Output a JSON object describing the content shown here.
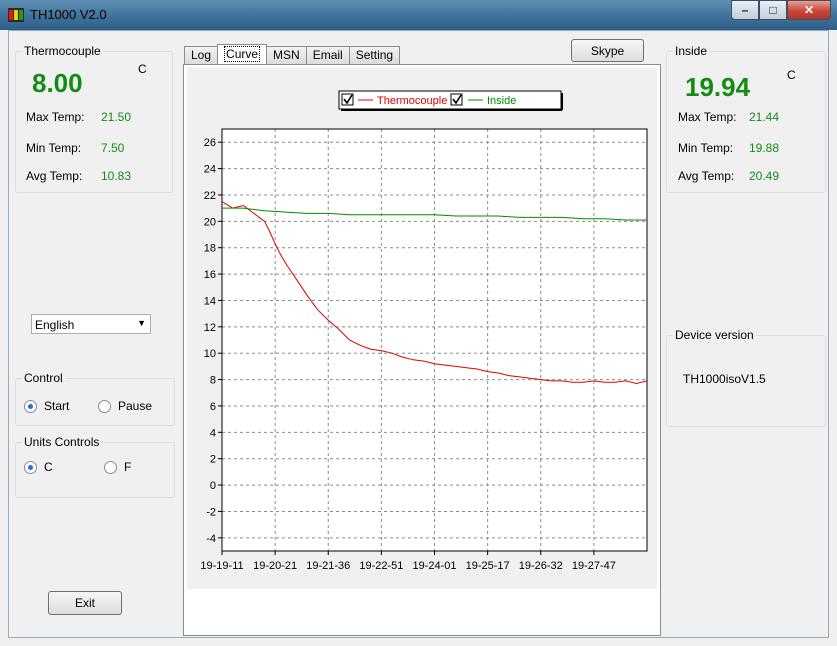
{
  "window": {
    "title": "TH1000 V2.0"
  },
  "thermocouple": {
    "group_label": "Thermocouple",
    "value": "8.00",
    "unit": "C",
    "max_label": "Max Temp:",
    "max_value": "21.50",
    "min_label": "Min Temp:",
    "min_value": "7.50",
    "avg_label": "Avg Temp:",
    "avg_value": "10.83"
  },
  "inside": {
    "group_label": "Inside",
    "value": "19.94",
    "unit": "C",
    "max_label": "Max Temp:",
    "max_value": "21.44",
    "min_label": "Min Temp:",
    "min_value": "19.88",
    "avg_label": "Avg Temp:",
    "avg_value": "20.49"
  },
  "language": {
    "selected": "English"
  },
  "control": {
    "group_label": "Control",
    "start_label": "Start",
    "pause_label": "Pause",
    "selected": "Start"
  },
  "units": {
    "group_label": "Units Controls",
    "c_label": "C",
    "f_label": "F",
    "selected": "C"
  },
  "exit_label": "Exit",
  "skype_label": "Skype",
  "tabs": [
    "Log",
    "Curve",
    "MSN",
    "Email",
    "Setting"
  ],
  "active_tab": "Curve",
  "device": {
    "group_label": "Device version",
    "version": "TH1000isoV1.5"
  },
  "colors": {
    "value_green": "#148c14",
    "thermocouple_series": "#e00000",
    "inside_series": "#008c00"
  },
  "chart_data": {
    "type": "line",
    "legend": [
      "Thermocouple",
      "Inside"
    ],
    "legend_checked": [
      true,
      true
    ],
    "grid": true,
    "ylim": [
      -5,
      27
    ],
    "yticks": [
      26,
      24,
      22,
      20,
      18,
      16,
      14,
      12,
      10,
      8,
      6,
      4,
      2,
      0,
      -2,
      -4
    ],
    "xtick_labels": [
      "19-19-11",
      "19-20-21",
      "19-21-36",
      "19-22-51",
      "19-24-01",
      "19-25-17",
      "19-26-32",
      "19-27-47"
    ],
    "x_range": [
      0,
      80
    ],
    "series": [
      {
        "name": "Thermocouple",
        "color": "#e00000",
        "x": [
          0,
          2,
          4,
          6,
          8,
          9,
          10,
          11,
          12,
          14,
          16,
          18,
          20,
          22,
          24,
          26,
          28,
          30,
          32,
          34,
          36,
          38,
          40,
          42,
          44,
          46,
          48,
          50,
          52,
          54,
          56,
          58,
          60,
          62,
          64,
          66,
          68,
          70,
          72,
          74,
          76,
          78,
          80
        ],
        "y": [
          21.5,
          21.0,
          21.2,
          20.6,
          20.0,
          19.2,
          18.3,
          17.5,
          16.8,
          15.6,
          14.4,
          13.3,
          12.5,
          11.8,
          11.0,
          10.6,
          10.3,
          10.2,
          10.0,
          9.7,
          9.5,
          9.4,
          9.2,
          9.1,
          9.0,
          8.9,
          8.8,
          8.6,
          8.5,
          8.3,
          8.2,
          8.1,
          8.0,
          7.9,
          7.9,
          7.8,
          7.8,
          7.9,
          7.8,
          7.8,
          7.9,
          7.7,
          7.9
        ]
      },
      {
        "name": "Inside",
        "color": "#008c00",
        "x": [
          0,
          4,
          8,
          12,
          16,
          20,
          24,
          28,
          32,
          36,
          40,
          44,
          48,
          52,
          56,
          60,
          64,
          68,
          72,
          76,
          80
        ],
        "y": [
          21.0,
          21.0,
          20.8,
          20.7,
          20.6,
          20.6,
          20.5,
          20.5,
          20.5,
          20.5,
          20.5,
          20.4,
          20.4,
          20.4,
          20.3,
          20.3,
          20.3,
          20.2,
          20.2,
          20.1,
          20.1
        ]
      }
    ]
  }
}
